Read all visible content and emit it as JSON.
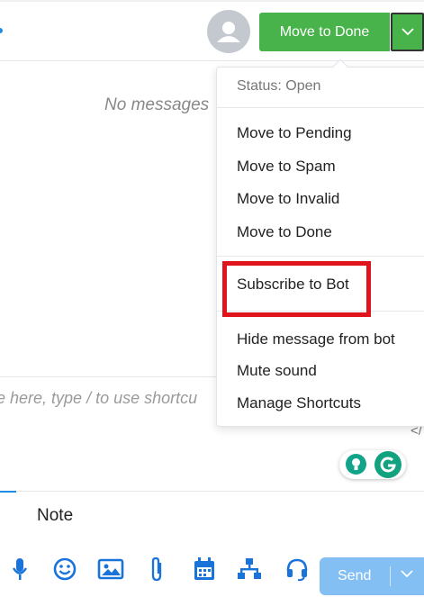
{
  "header": {
    "primary_action_label": "Move to Done"
  },
  "conversation": {
    "empty_text": "No messages"
  },
  "status_menu": {
    "status_label": "Status: Open",
    "status_items": [
      "Move to Pending",
      "Move to Spam",
      "Move to Invalid",
      "Move to Done"
    ],
    "bot_item": "Subscribe to Bot",
    "other_items": [
      "Hide message from bot",
      "Mute sound",
      "Manage Shortcuts"
    ]
  },
  "composer": {
    "placeholder": "e here, type / to use shortcu",
    "code_toggle": "</"
  },
  "note_tab": {
    "label": "Note"
  },
  "toolbar": {
    "send_label": "Send"
  },
  "colors": {
    "done_green": "#49b34b",
    "send_blue": "#84bff3",
    "toolbar_icon_blue": "#1a73d9",
    "highlight_red": "#e0141c"
  }
}
